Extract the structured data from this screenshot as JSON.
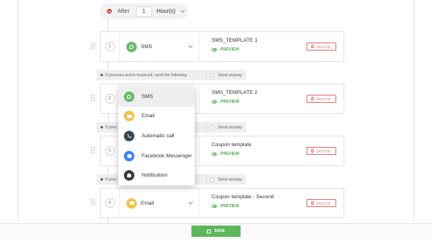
{
  "after": {
    "label": "After",
    "value": "1",
    "unit": "Hour(s)"
  },
  "steps": [
    {
      "num": "1",
      "channel": "SMS",
      "channel_icon": "sms-icon",
      "channel_color": "#66bb6a",
      "template": "SMS_TEMPLATE 1",
      "preview": "PREVIEW",
      "delete": "DELETE"
    },
    {
      "num": "2",
      "channel": "",
      "channel_icon": "",
      "channel_color": "",
      "template": "SMS_TEMPLATE 2",
      "preview": "PREVIEW",
      "delete": "DELETE"
    },
    {
      "num": "3",
      "channel": "",
      "channel_icon": "",
      "channel_color": "",
      "template": "Coupon template",
      "preview": "PREVIEW",
      "delete": "DELETE"
    },
    {
      "num": "4",
      "channel": "Email",
      "channel_icon": "email-icon",
      "channel_color": "#f2c04a",
      "template": "Coupon template - Second",
      "preview": "PREVIEW",
      "delete": "DELETE"
    }
  ],
  "conditions": [
    {
      "text": "If previous action bounced, send the following",
      "anyway": "Send anyway"
    },
    {
      "text": "If prev",
      "anyway": "Send anyway"
    },
    {
      "text": "If prev",
      "anyway": "Send anyway"
    }
  ],
  "dropdown": {
    "items": [
      {
        "label": "SMS",
        "icon": "sms-icon",
        "color": "#66bb6a",
        "active": true
      },
      {
        "label": "Email",
        "icon": "email-icon",
        "color": "#f2c04a",
        "active": false
      },
      {
        "label": "Automatic call",
        "icon": "phone-icon",
        "color": "#37474f",
        "active": false
      },
      {
        "label": "Facebook Messenger",
        "icon": "messenger-icon",
        "color": "#3b82f6",
        "active": false
      },
      {
        "label": "Notification",
        "icon": "bell-icon",
        "color": "#3a3a3a",
        "active": false
      }
    ]
  },
  "footer": {
    "save_label": "SAVE"
  }
}
